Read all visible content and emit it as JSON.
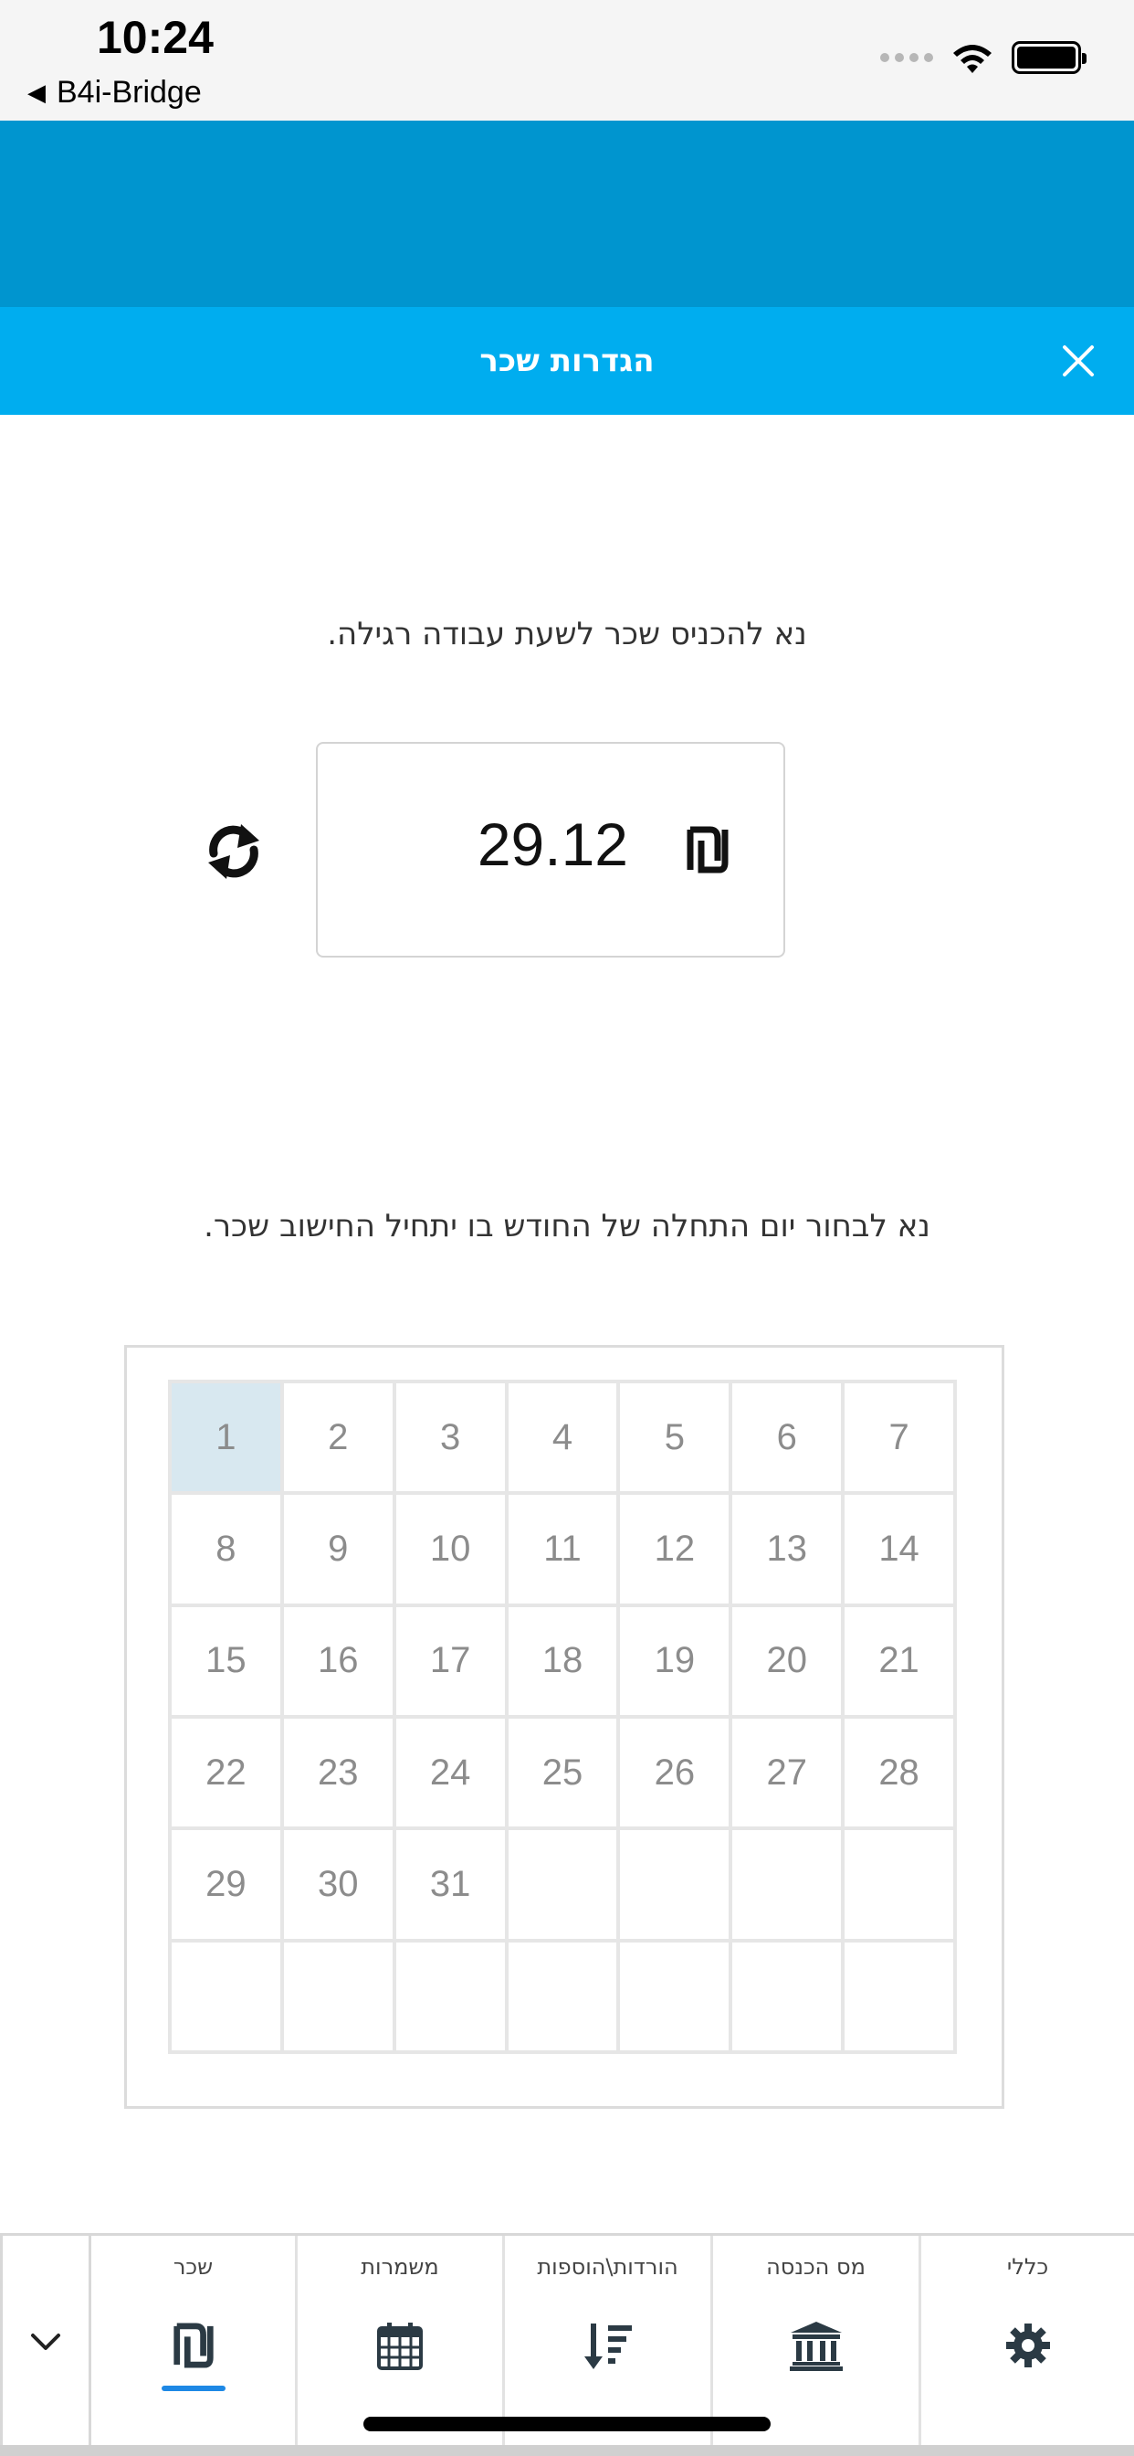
{
  "status_bar": {
    "time": "10:24",
    "back_label": "B4i-Bridge",
    "back_icon": "back-triangle-icon",
    "wifi_icon": "wifi-icon",
    "battery_icon": "battery-icon"
  },
  "title_bar": {
    "title": "הגדרות שכר",
    "close_icon": "close-icon"
  },
  "wage": {
    "prompt": "נא להכניס שכר לשעת עבודה רגילה.",
    "value": "29.12",
    "currency_icon": "shekel-icon",
    "refresh_icon": "refresh-icon"
  },
  "calendar": {
    "prompt": "נא לבחור יום התחלה של החודש בו יתחיל החישוב שכר.",
    "selected_day": "1",
    "days": [
      "1",
      "2",
      "3",
      "4",
      "5",
      "6",
      "7",
      "8",
      "9",
      "10",
      "11",
      "12",
      "13",
      "14",
      "15",
      "16",
      "17",
      "18",
      "19",
      "20",
      "21",
      "22",
      "23",
      "24",
      "25",
      "26",
      "27",
      "28",
      "29",
      "30",
      "31",
      "",
      "",
      "",
      "",
      "",
      "",
      "",
      "",
      "",
      "",
      ""
    ]
  },
  "tabbar": {
    "collapse_icon": "chevron-down-icon",
    "tabs": [
      {
        "label": "שכר",
        "icon": "shekel-icon",
        "active": true
      },
      {
        "label": "משמרות",
        "icon": "calendar-icon",
        "active": false
      },
      {
        "label": "הורדות\\הוספות",
        "icon": "sort-descending-icon",
        "active": false
      },
      {
        "label": "מס הכנסה",
        "icon": "bank-icon",
        "active": false
      },
      {
        "label": "כללי",
        "icon": "gear-icon",
        "active": false
      }
    ]
  },
  "colors": {
    "header": "#0095cf",
    "title_bar": "#00adef",
    "selected_day": "#d8e8f0",
    "active_tab_underline": "#1e88e5"
  }
}
